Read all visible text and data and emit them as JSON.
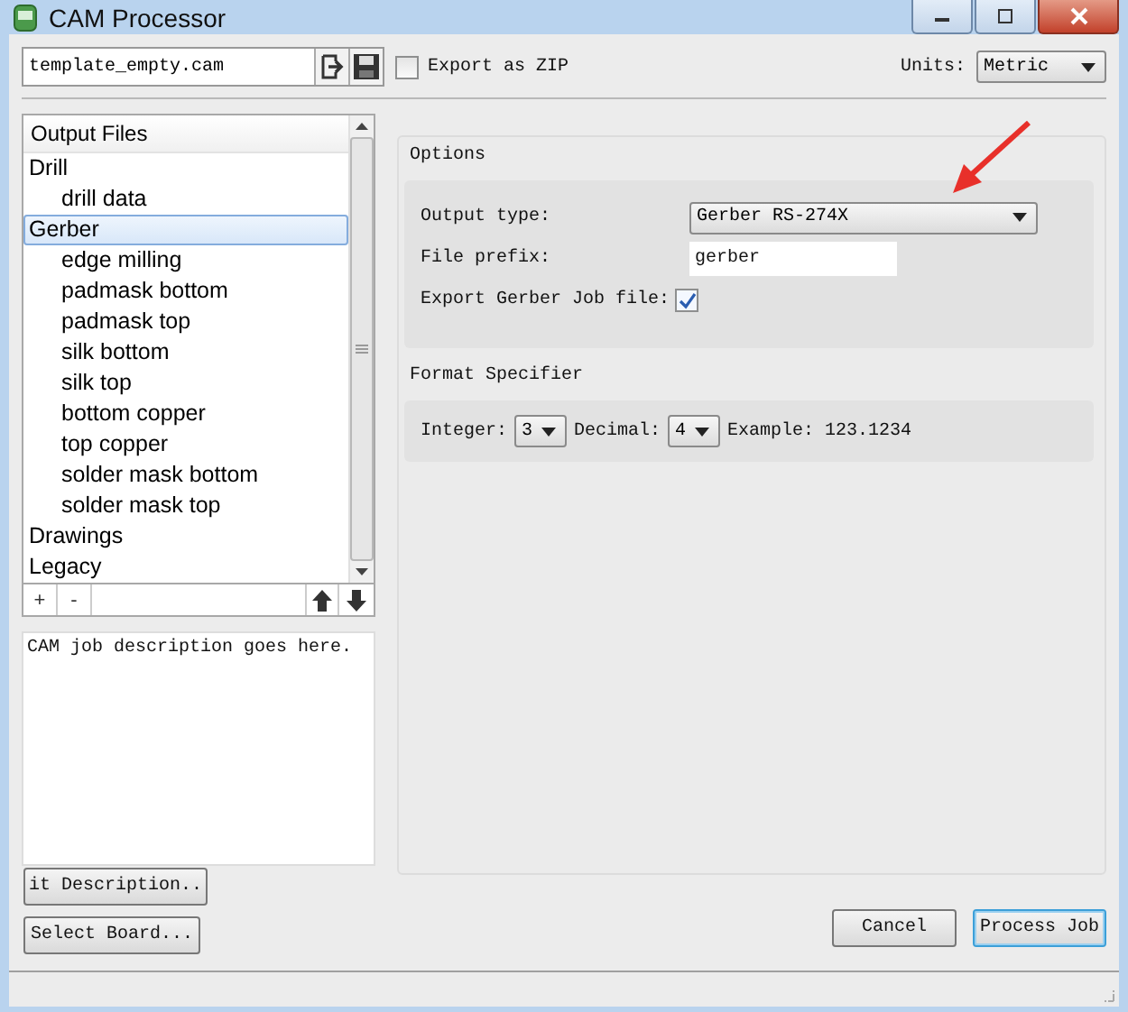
{
  "window": {
    "title": "CAM Processor"
  },
  "toolbar": {
    "job_file": "template_empty.cam",
    "export_zip": {
      "label": "Export as ZIP",
      "checked": false
    },
    "units_label": "Units:",
    "units": "Metric"
  },
  "output_files": {
    "header": "Output Files",
    "add": "+",
    "remove": "-",
    "items": [
      {
        "label": "Drill",
        "selected": false,
        "children": [
          {
            "label": "drill data",
            "selected": false
          }
        ]
      },
      {
        "label": "Gerber",
        "selected": true,
        "children": [
          {
            "label": "edge milling",
            "selected": false
          },
          {
            "label": "padmask bottom",
            "selected": false
          },
          {
            "label": "padmask top",
            "selected": false
          },
          {
            "label": "silk bottom",
            "selected": false
          },
          {
            "label": "silk top",
            "selected": false
          },
          {
            "label": "bottom copper",
            "selected": false
          },
          {
            "label": "top copper",
            "selected": false
          },
          {
            "label": "solder mask bottom",
            "selected": false
          },
          {
            "label": "solder mask top",
            "selected": false
          }
        ]
      },
      {
        "label": "Drawings",
        "selected": false
      },
      {
        "label": "Legacy",
        "selected": false
      }
    ]
  },
  "description": "CAM job description goes here.",
  "edit_description_button": "it Description..",
  "select_board_button": "Select Board...",
  "options": {
    "title": "Options",
    "output_type_label": "Output type:",
    "output_type": "Gerber RS-274X",
    "file_prefix_label": "File prefix:",
    "file_prefix": "gerber",
    "export_job_label": "Export Gerber Job file:",
    "export_job_checked": true
  },
  "format": {
    "title": "Format Specifier",
    "integer_label": "Integer:",
    "integer": "3",
    "decimal_label": "Decimal:",
    "decimal": "4",
    "example": "Example: 123.1234"
  },
  "buttons": {
    "cancel": "Cancel",
    "process": "Process Job"
  }
}
